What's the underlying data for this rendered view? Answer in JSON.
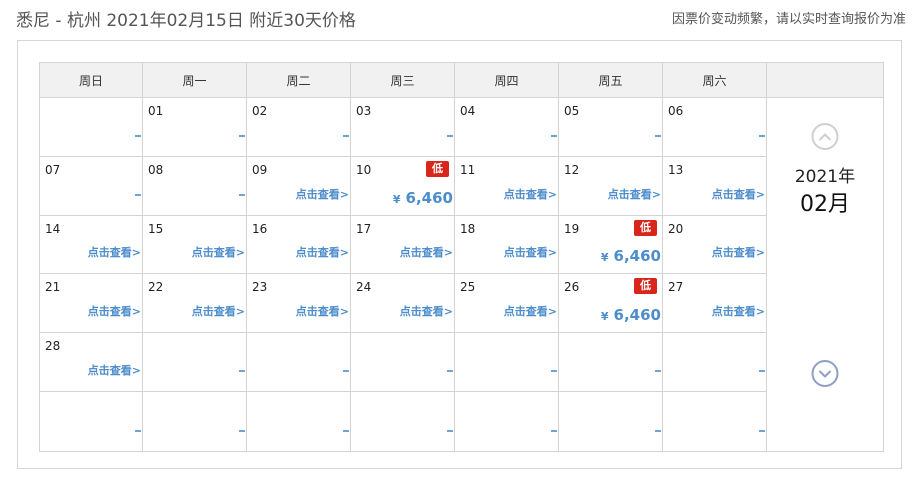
{
  "header": {
    "title": "悉尼 - 杭州 2021年02月15日  附近30天价格",
    "notice": "因票价变动频繁，请以实时查询报价为准"
  },
  "weekdays": [
    "周日",
    "周一",
    "周二",
    "周三",
    "周四",
    "周五",
    "周六"
  ],
  "side": {
    "year": "2021年",
    "month": "02月"
  },
  "view_label": "点击查看>",
  "low_badge": "低",
  "currency": "¥",
  "colors": {
    "link": "#4d8dcc",
    "badge": "#d9261c"
  },
  "cells": [
    {
      "day": "",
      "kind": "dash"
    },
    {
      "day": "01",
      "kind": "dash"
    },
    {
      "day": "02",
      "kind": "dash"
    },
    {
      "day": "03",
      "kind": "dash"
    },
    {
      "day": "04",
      "kind": "dash"
    },
    {
      "day": "05",
      "kind": "dash"
    },
    {
      "day": "06",
      "kind": "dash"
    },
    {
      "day": "07",
      "kind": "dash"
    },
    {
      "day": "08",
      "kind": "dash"
    },
    {
      "day": "09",
      "kind": "view"
    },
    {
      "day": "10",
      "kind": "price",
      "low": true,
      "price": "6,460"
    },
    {
      "day": "11",
      "kind": "view"
    },
    {
      "day": "12",
      "kind": "view"
    },
    {
      "day": "13",
      "kind": "view"
    },
    {
      "day": "14",
      "kind": "view"
    },
    {
      "day": "15",
      "kind": "view"
    },
    {
      "day": "16",
      "kind": "view"
    },
    {
      "day": "17",
      "kind": "view"
    },
    {
      "day": "18",
      "kind": "view"
    },
    {
      "day": "19",
      "kind": "price",
      "low": true,
      "price": "6,460"
    },
    {
      "day": "20",
      "kind": "view"
    },
    {
      "day": "21",
      "kind": "view"
    },
    {
      "day": "22",
      "kind": "view"
    },
    {
      "day": "23",
      "kind": "view"
    },
    {
      "day": "24",
      "kind": "view"
    },
    {
      "day": "25",
      "kind": "view"
    },
    {
      "day": "26",
      "kind": "price",
      "low": true,
      "price": "6,460"
    },
    {
      "day": "27",
      "kind": "view"
    },
    {
      "day": "28",
      "kind": "view"
    },
    {
      "day": "",
      "kind": "dash"
    },
    {
      "day": "",
      "kind": "dash"
    },
    {
      "day": "",
      "kind": "dash"
    },
    {
      "day": "",
      "kind": "dash"
    },
    {
      "day": "",
      "kind": "dash"
    },
    {
      "day": "",
      "kind": "dash"
    },
    {
      "day": "",
      "kind": "dash"
    },
    {
      "day": "",
      "kind": "dash"
    },
    {
      "day": "",
      "kind": "dash"
    },
    {
      "day": "",
      "kind": "dash"
    },
    {
      "day": "",
      "kind": "dash"
    },
    {
      "day": "",
      "kind": "dash"
    },
    {
      "day": "",
      "kind": "dash"
    }
  ]
}
